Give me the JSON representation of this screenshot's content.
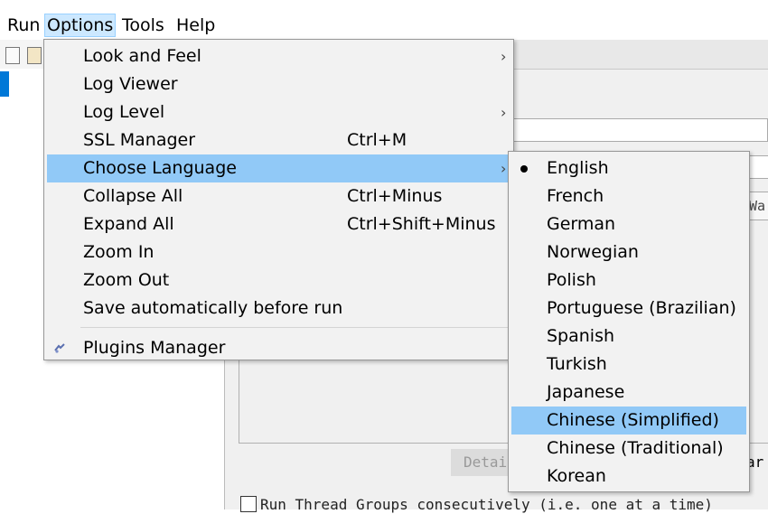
{
  "menubar": {
    "items": [
      {
        "label": "Run",
        "active": false
      },
      {
        "label": "Options",
        "active": true
      },
      {
        "label": "Tools",
        "active": false
      },
      {
        "label": "Help",
        "active": false
      }
    ]
  },
  "options_menu": {
    "items": [
      {
        "label": "Look and Feel",
        "shortcut": "",
        "submenu": true
      },
      {
        "label": "Log Viewer",
        "shortcut": "",
        "submenu": false
      },
      {
        "label": "Log Level",
        "shortcut": "",
        "submenu": true
      },
      {
        "label": "SSL Manager",
        "shortcut": "Ctrl+M",
        "submenu": false
      },
      {
        "label": "Choose Language",
        "shortcut": "",
        "submenu": true,
        "highlighted": true
      },
      {
        "label": "Collapse All",
        "shortcut": "Ctrl+Minus",
        "submenu": false
      },
      {
        "label": "Expand All",
        "shortcut": "Ctrl+Shift+Minus",
        "submenu": false
      },
      {
        "label": "Zoom In",
        "shortcut": "",
        "submenu": false
      },
      {
        "label": "Zoom Out",
        "shortcut": "",
        "submenu": false
      },
      {
        "label": "Save automatically before run",
        "shortcut": "",
        "submenu": false
      },
      {
        "label": "Plugins Manager",
        "shortcut": "",
        "submenu": false,
        "icon": "plugins-icon"
      }
    ],
    "submenu_arrow": "›"
  },
  "language_menu": {
    "items": [
      {
        "label": "English",
        "selected": true
      },
      {
        "label": "French"
      },
      {
        "label": "German"
      },
      {
        "label": "Norwegian"
      },
      {
        "label": "Polish"
      },
      {
        "label": "Portuguese (Brazilian)"
      },
      {
        "label": "Spanish"
      },
      {
        "label": "Turkish"
      },
      {
        "label": "Japanese"
      },
      {
        "label": "Chinese (Simplified)",
        "highlighted": true
      },
      {
        "label": "Chinese (Traditional)"
      },
      {
        "label": "Korean"
      }
    ]
  },
  "background": {
    "warn_fragment": "Wa",
    "details_fragment": "Detai",
    "clear_fragment": "ar",
    "run_thread_groups": "Run Thread Groups consecutively (i.e. one at a time)"
  },
  "colors": {
    "menu_bg": "#f2f2f2",
    "highlight": "#91c9f7",
    "menubar_active": "#cce8ff",
    "tree_selection": "#0078d7"
  }
}
